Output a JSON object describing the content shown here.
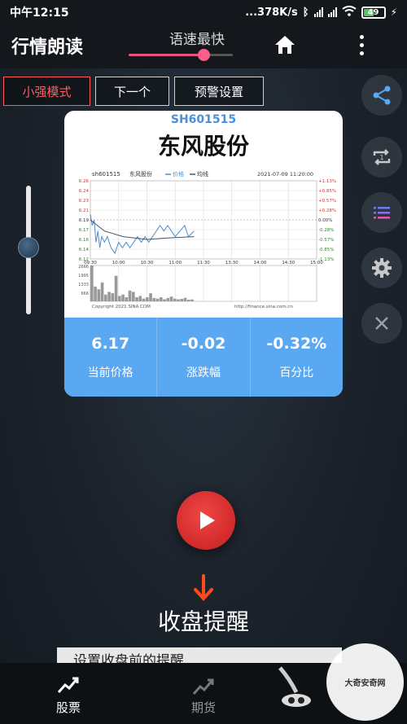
{
  "status_bar": {
    "time": "中午12:15",
    "network_speed": "...378K/s",
    "battery": "49"
  },
  "header": {
    "title": "行情朗读",
    "speed_label": "语速最快",
    "speed_level": 0.72
  },
  "modes": [
    {
      "label": "小强模式",
      "active": true
    },
    {
      "label": "下一个",
      "active": false
    },
    {
      "label": "预警设置",
      "active": false
    }
  ],
  "volume_level": 0.52,
  "side_buttons": [
    "share-icon",
    "repeat-icon",
    "list-icon",
    "settings-icon",
    "close-icon"
  ],
  "stock": {
    "code": "SH601515",
    "name": "东风股份",
    "stats": [
      {
        "value": "6.17",
        "label": "当前价格"
      },
      {
        "value": "-0.02",
        "label": "涨跌幅"
      },
      {
        "value": "-0.32%",
        "label": "百分比"
      }
    ]
  },
  "chart_data": {
    "type": "line",
    "header_code": "sh601515",
    "header_name": "东风股份",
    "legend": [
      "价格",
      "均线"
    ],
    "date": "2021-07-09 11:20:00",
    "price_ticks": [
      "6.26",
      "6.24",
      "6.23",
      "6.21",
      "6.19",
      "6.17",
      "6.16",
      "6.14",
      "6.12"
    ],
    "pct_ticks": [
      "+1.13%",
      "+0.85%",
      "+0.57%",
      "+0.28%",
      "0.00%",
      "-0.28%",
      "-0.57%",
      "-0.85%",
      "-1.13%"
    ],
    "time_ticks": [
      "09:30",
      "10:00",
      "10:30",
      "11:00",
      "11:30",
      "13:30",
      "14:00",
      "14:30",
      "15:00"
    ],
    "volume_ticks": [
      "2666",
      "1995",
      "1333",
      "666"
    ],
    "ylim": [
      6.12,
      6.26
    ],
    "prev_close": 6.19,
    "price": [
      {
        "t": 0,
        "v": 6.2
      },
      {
        "t": 2,
        "v": 6.18
      },
      {
        "t": 4,
        "v": 6.19
      },
      {
        "t": 6,
        "v": 6.15
      },
      {
        "t": 8,
        "v": 6.17
      },
      {
        "t": 10,
        "v": 6.14
      },
      {
        "t": 12,
        "v": 6.16
      },
      {
        "t": 15,
        "v": 6.15
      },
      {
        "t": 18,
        "v": 6.16
      },
      {
        "t": 22,
        "v": 6.14
      },
      {
        "t": 26,
        "v": 6.13
      },
      {
        "t": 30,
        "v": 6.15
      },
      {
        "t": 34,
        "v": 6.14
      },
      {
        "t": 38,
        "v": 6.15
      },
      {
        "t": 42,
        "v": 6.14
      },
      {
        "t": 46,
        "v": 6.15
      },
      {
        "t": 50,
        "v": 6.16
      },
      {
        "t": 54,
        "v": 6.15
      },
      {
        "t": 58,
        "v": 6.16
      },
      {
        "t": 62,
        "v": 6.15
      },
      {
        "t": 66,
        "v": 6.16
      },
      {
        "t": 70,
        "v": 6.17
      },
      {
        "t": 74,
        "v": 6.18
      },
      {
        "t": 78,
        "v": 6.17
      },
      {
        "t": 82,
        "v": 6.18
      },
      {
        "t": 86,
        "v": 6.17
      },
      {
        "t": 90,
        "v": 6.16
      },
      {
        "t": 95,
        "v": 6.17
      },
      {
        "t": 100,
        "v": 6.18
      },
      {
        "t": 104,
        "v": 6.16
      },
      {
        "t": 110,
        "v": 6.17
      }
    ],
    "avg": [
      {
        "t": 0,
        "v": 6.19
      },
      {
        "t": 15,
        "v": 6.17
      },
      {
        "t": 35,
        "v": 6.16
      },
      {
        "t": 60,
        "v": 6.155
      },
      {
        "t": 85,
        "v": 6.158
      },
      {
        "t": 110,
        "v": 6.16
      }
    ],
    "volume": [
      2666,
      1100,
      900,
      1400,
      500,
      700,
      600,
      1900,
      400,
      500,
      300,
      800,
      700,
      300,
      400,
      200,
      300,
      600,
      250,
      200,
      300,
      150,
      250,
      350,
      200,
      150,
      180,
      260,
      120,
      140
    ],
    "copyright": "Copyright 2021 SINA.COM",
    "url": "http://finance.sina.com.cn"
  },
  "alert": {
    "title": "收盘提醒",
    "input_text": "设置收盘前的提醒"
  },
  "bottom_nav": [
    {
      "label": "股票",
      "active": true
    },
    {
      "label": "期货",
      "active": false
    }
  ],
  "watermark": "大奇安奇网"
}
